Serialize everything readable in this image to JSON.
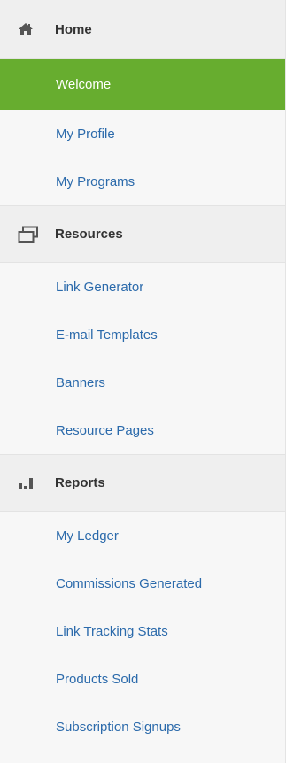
{
  "sidebar": {
    "sections": [
      {
        "label": "Home",
        "icon": "home-icon",
        "items": [
          {
            "label": "Welcome",
            "active": true
          },
          {
            "label": "My Profile"
          },
          {
            "label": "My Programs"
          }
        ]
      },
      {
        "label": "Resources",
        "icon": "windows-icon",
        "items": [
          {
            "label": "Link Generator"
          },
          {
            "label": "E-mail Templates"
          },
          {
            "label": "Banners"
          },
          {
            "label": "Resource Pages"
          }
        ]
      },
      {
        "label": "Reports",
        "icon": "bar-chart-icon",
        "items": [
          {
            "label": "My Ledger"
          },
          {
            "label": "Commissions Generated"
          },
          {
            "label": "Link Tracking Stats"
          },
          {
            "label": "Products Sold"
          },
          {
            "label": "Subscription Signups"
          }
        ]
      }
    ],
    "colors": {
      "active_bg": "#67ad2f",
      "link": "#2b6aab",
      "header_bg": "#efefef"
    }
  }
}
